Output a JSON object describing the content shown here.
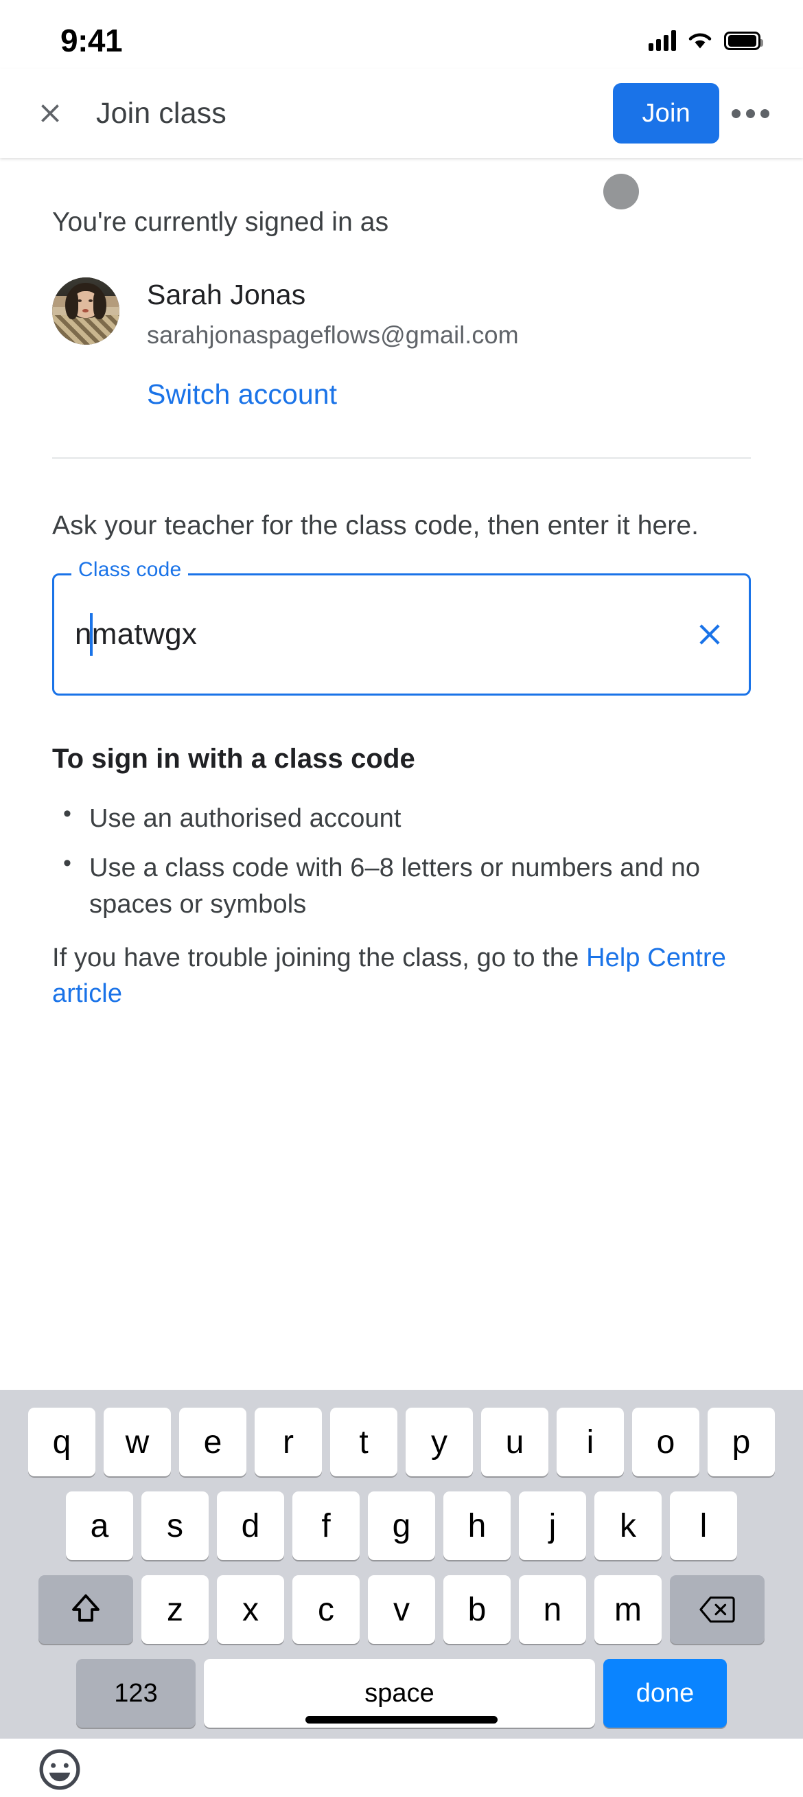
{
  "status_bar": {
    "time": "9:41",
    "signal_icon": "cellular-signal-icon",
    "wifi_icon": "wifi-icon",
    "battery_icon": "battery-icon"
  },
  "app_bar": {
    "close_icon": "close-icon",
    "title": "Join class",
    "join_label": "Join",
    "more_icon": "overflow-menu-icon",
    "accent_color": "#1a73e8"
  },
  "content": {
    "signed_in_label": "You're currently signed in as",
    "account": {
      "name": "Sarah Jonas",
      "email": "sarahjonaspageflows@gmail.com",
      "switch_label": "Switch account",
      "avatar_icon": "user-avatar-photo"
    },
    "ask_text": "Ask your teacher for the class code, then enter it here.",
    "class_code_field": {
      "legend": "Class code",
      "value": "nmatwgx",
      "placeholder": "Class code",
      "clear_icon": "clear-icon",
      "focus_color": "#1a73e8"
    },
    "help_section": {
      "title": "To sign in with a class code",
      "bullets": [
        "Use an authorised account",
        "Use a class code with 6–8 letters or numbers and no spaces or symbols"
      ],
      "trouble_prefix": "If you have trouble joining the class, go to the ",
      "trouble_link": "Help Centre article"
    }
  },
  "keyboard": {
    "row1": [
      "q",
      "w",
      "e",
      "r",
      "t",
      "y",
      "u",
      "i",
      "o",
      "p"
    ],
    "row2": [
      "a",
      "s",
      "d",
      "f",
      "g",
      "h",
      "j",
      "k",
      "l"
    ],
    "row3": [
      "z",
      "x",
      "c",
      "v",
      "b",
      "n",
      "m"
    ],
    "shift_icon": "shift-icon",
    "backspace_icon": "backspace-icon",
    "numbers_label": "123",
    "space_label": "space",
    "done_label": "done",
    "emoji_icon": "emoji-icon",
    "done_color": "#0a84ff"
  },
  "home_indicator": "home-indicator"
}
